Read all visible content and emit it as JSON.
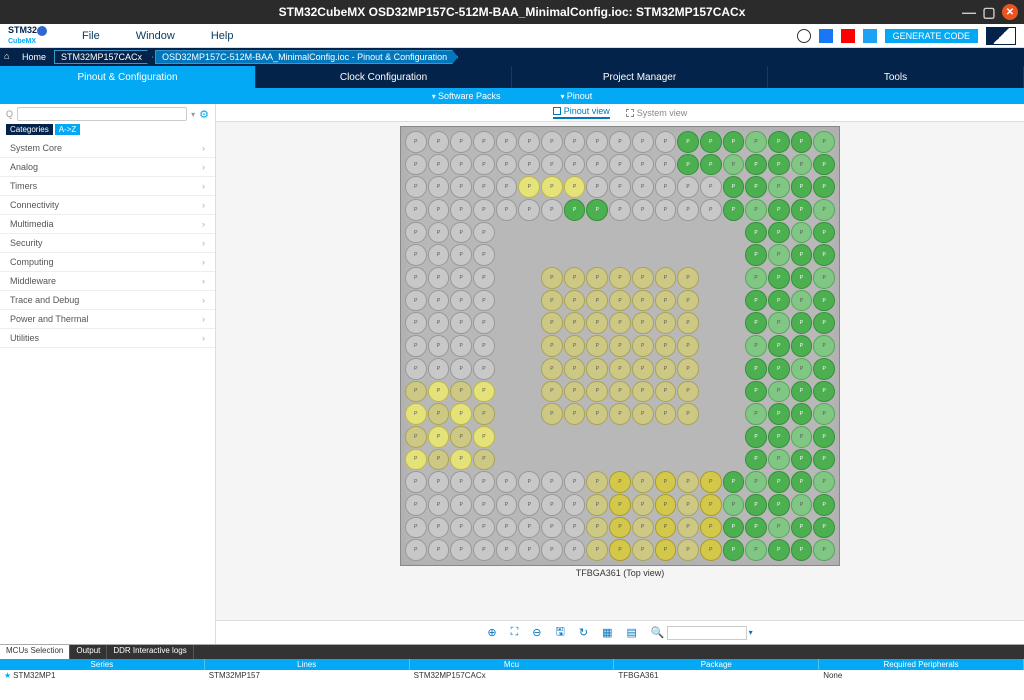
{
  "title": "STM32CubeMX OSD32MP157C-512M-BAA_MinimalConfig.ioc: STM32MP157CACx",
  "menu": {
    "file": "File",
    "window": "Window",
    "help": "Help"
  },
  "generate": "GENERATE CODE",
  "breadcrumb": {
    "home": "Home",
    "part": "STM32MP157CACx",
    "path": "OSD32MP157C-512M-BAA_MinimalConfig.ioc - Pinout & Configuration"
  },
  "tabs": {
    "pinout": "Pinout & Configuration",
    "clock": "Clock Configuration",
    "project": "Project Manager",
    "tools": "Tools"
  },
  "subbar": {
    "sw": "Software Packs",
    "pn": "Pinout"
  },
  "search": {
    "q": "Q",
    "placeholder": ""
  },
  "filters": {
    "cat": "Categories",
    "az": "A->Z"
  },
  "categories": [
    "System Core",
    "Analog",
    "Timers",
    "Connectivity",
    "Multimedia",
    "Security",
    "Computing",
    "Middleware",
    "Trace and Debug",
    "Power and Thermal",
    "Utilities"
  ],
  "view": {
    "pinout": "Pinout view",
    "system": "System view"
  },
  "chip_caption": "TFBGA361 (Top view)",
  "bp_tabs": {
    "mcu": "MCUs Selection",
    "output": "Output",
    "ddr": "DDR Interactive logs"
  },
  "bp_headers": {
    "series": "Series",
    "lines": "Lines",
    "mcu": "Mcu",
    "package": "Package",
    "req": "Required Peripherals"
  },
  "bp_row": {
    "series": "STM32MP1",
    "lines": "STM32MP157",
    "mcu": "STM32MP157CACx",
    "package": "TFBGA361",
    "req": "None"
  }
}
